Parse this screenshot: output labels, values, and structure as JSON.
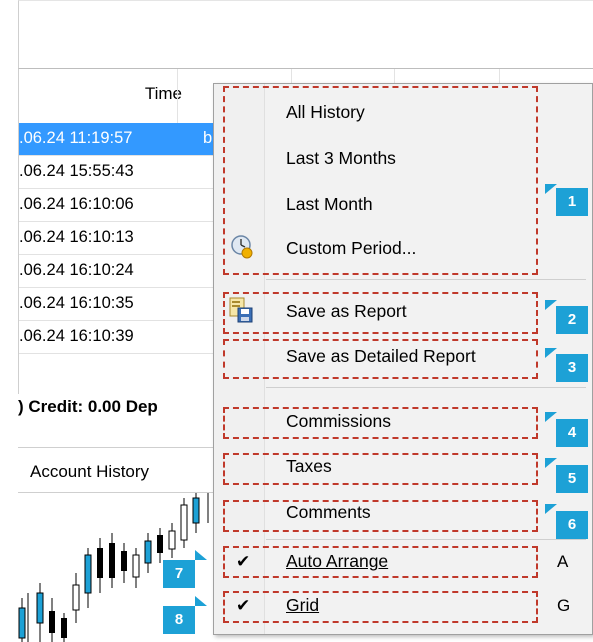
{
  "table": {
    "header_time": "Time",
    "rows": [
      {
        "time": ".06.24 11:19:57",
        "selected": true,
        "extra": "b"
      },
      {
        "time": ".06.24 15:55:43"
      },
      {
        "time": ".06.24 16:10:06"
      },
      {
        "time": ".06.24 16:10:13"
      },
      {
        "time": ".06.24 16:10:24"
      },
      {
        "time": ".06.24 16:10:35"
      },
      {
        "time": ".06.24 16:10:39"
      }
    ]
  },
  "summary": {
    "text": ") Credit: 0.00  Dep"
  },
  "tabs": {
    "account_history": "Account History"
  },
  "menu": {
    "all_history": "All History",
    "last_3_months": "Last 3 Months",
    "last_month": "Last Month",
    "custom_period": "Custom Period...",
    "save_as_report": "Save as Report",
    "save_as_detailed_report": "Save as Detailed Report",
    "commissions": "Commissions",
    "taxes": "Taxes",
    "comments": "Comments",
    "auto_arrange": "Auto Arrange",
    "auto_arrange_shortcut": "A",
    "grid": "Grid",
    "grid_shortcut": "G",
    "check_mark": "✔"
  },
  "badges": [
    "1",
    "2",
    "3",
    "4",
    "5",
    "6",
    "7",
    "8"
  ],
  "colors": {
    "selection": "#3399ff",
    "annotation_box": "#c0392b",
    "badge": "#1da1d6"
  },
  "icons": {
    "custom_period": "clock-icon",
    "save_report": "save-report-icon"
  }
}
